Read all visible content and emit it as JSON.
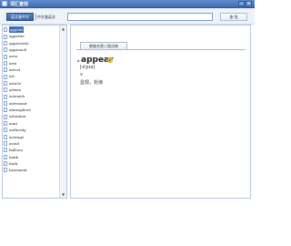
{
  "window": {
    "title": "词汇查找",
    "minimize_glyph": "–",
    "close_glyph": "×"
  },
  "toolbar": {
    "mode_active": "英文查中文",
    "mode_alt": "中文查英文",
    "search_value": "",
    "search_button": "查 找"
  },
  "word_list": [
    "appear",
    "appetite",
    "appreciate",
    "approach",
    "area",
    "arm",
    "arrest",
    "art",
    "article",
    "artiste",
    "astonish",
    "astronaut",
    "atmosphere",
    "attention",
    "aunt",
    "authority",
    "average",
    "avoid",
    "balloon",
    "bank",
    "bark",
    "basement"
  ],
  "entry": {
    "tab_label": "朗维合第二版词典",
    "word": "appear",
    "phonetic": "[ə'pɪə]",
    "part_of_speech": "v",
    "definition": "显现，扮演"
  },
  "colors": {
    "accent": "#3f6cb0",
    "selection": "#3f6db7"
  },
  "icons": [
    "app-icon",
    "document-icon",
    "speaker-icon"
  ]
}
